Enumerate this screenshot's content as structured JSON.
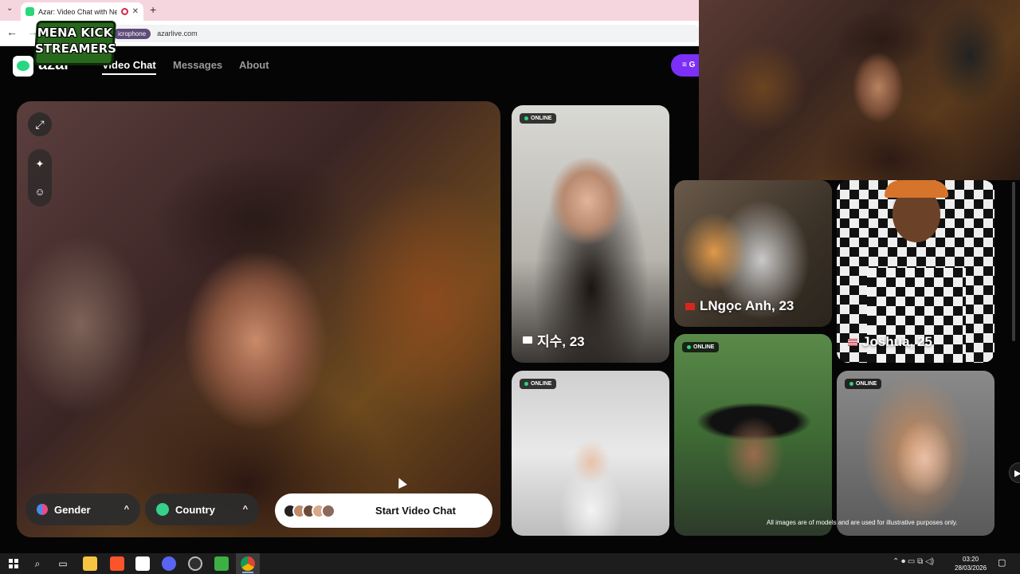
{
  "browser": {
    "tab_title": "Azar: Video Chat with New",
    "tab_close": "✕",
    "new_tab": "+",
    "tab_menu": "⌄",
    "mic_pill": "icrophone",
    "url": "azarlive.com",
    "back": "←",
    "forward": "→"
  },
  "overlay_logo": {
    "line1": "MENA KICK",
    "line2": "STREAMERS"
  },
  "nav": {
    "brand": "azar",
    "video_chat": "Video Chat",
    "messages": "Messages",
    "about": "About",
    "get_app": "≡ G"
  },
  "video": {
    "expand_icon": "⤢",
    "magic_icon": "✦",
    "face_icon": "☺",
    "gender_label": "Gender",
    "country_label": "Country",
    "chevron": "^",
    "start_label": "Start Video Chat"
  },
  "profiles": [
    {
      "name": "지수, 23",
      "status": "ONLINE",
      "flag": "kr"
    },
    {
      "name": "LNgọc Anh, 23",
      "status": "",
      "flag": "vn"
    },
    {
      "name": "Joshua, 25",
      "status": "",
      "flag": "us"
    },
    {
      "name": "",
      "status": "ONLINE",
      "flag": ""
    },
    {
      "name": "",
      "status": "ONLINE",
      "flag": ""
    },
    {
      "name": "",
      "status": "ONLINE",
      "flag": ""
    }
  ],
  "disclaimer": "All images are of models and are used for illustrative purposes only.",
  "taskbar": {
    "search_icon": "⌕",
    "taskview_icon": "▭",
    "tray": "⌃ ⏺ ▭ ⧉ ◁)",
    "time": "03:20",
    "date": "28/03/2026",
    "notif": "▢"
  },
  "colors": {
    "accent": "#7b2ff7",
    "online": "#2bd67b",
    "brand": "#28d880"
  }
}
